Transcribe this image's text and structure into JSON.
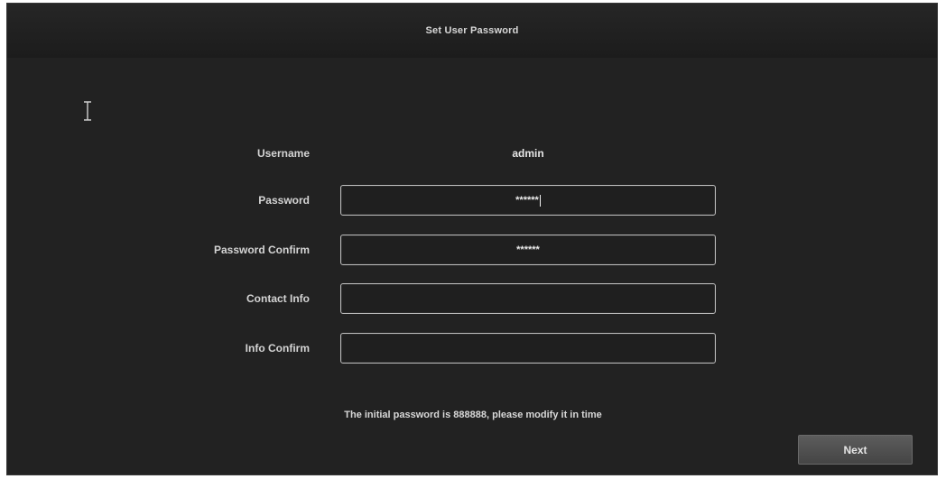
{
  "window": {
    "title": "Set User Password"
  },
  "form": {
    "username": {
      "label": "Username",
      "value": "admin"
    },
    "password": {
      "label": "Password",
      "value": "******"
    },
    "password_confirm": {
      "label": "Password Confirm",
      "value": "******"
    },
    "contact_info": {
      "label": "Contact Info",
      "value": ""
    },
    "info_confirm": {
      "label": "Info Confirm",
      "value": ""
    }
  },
  "hint": "The initial password is 888888, please modify it in time",
  "buttons": {
    "next_label": "Next"
  },
  "icons": {
    "cursor": "text-cursor-icon"
  }
}
